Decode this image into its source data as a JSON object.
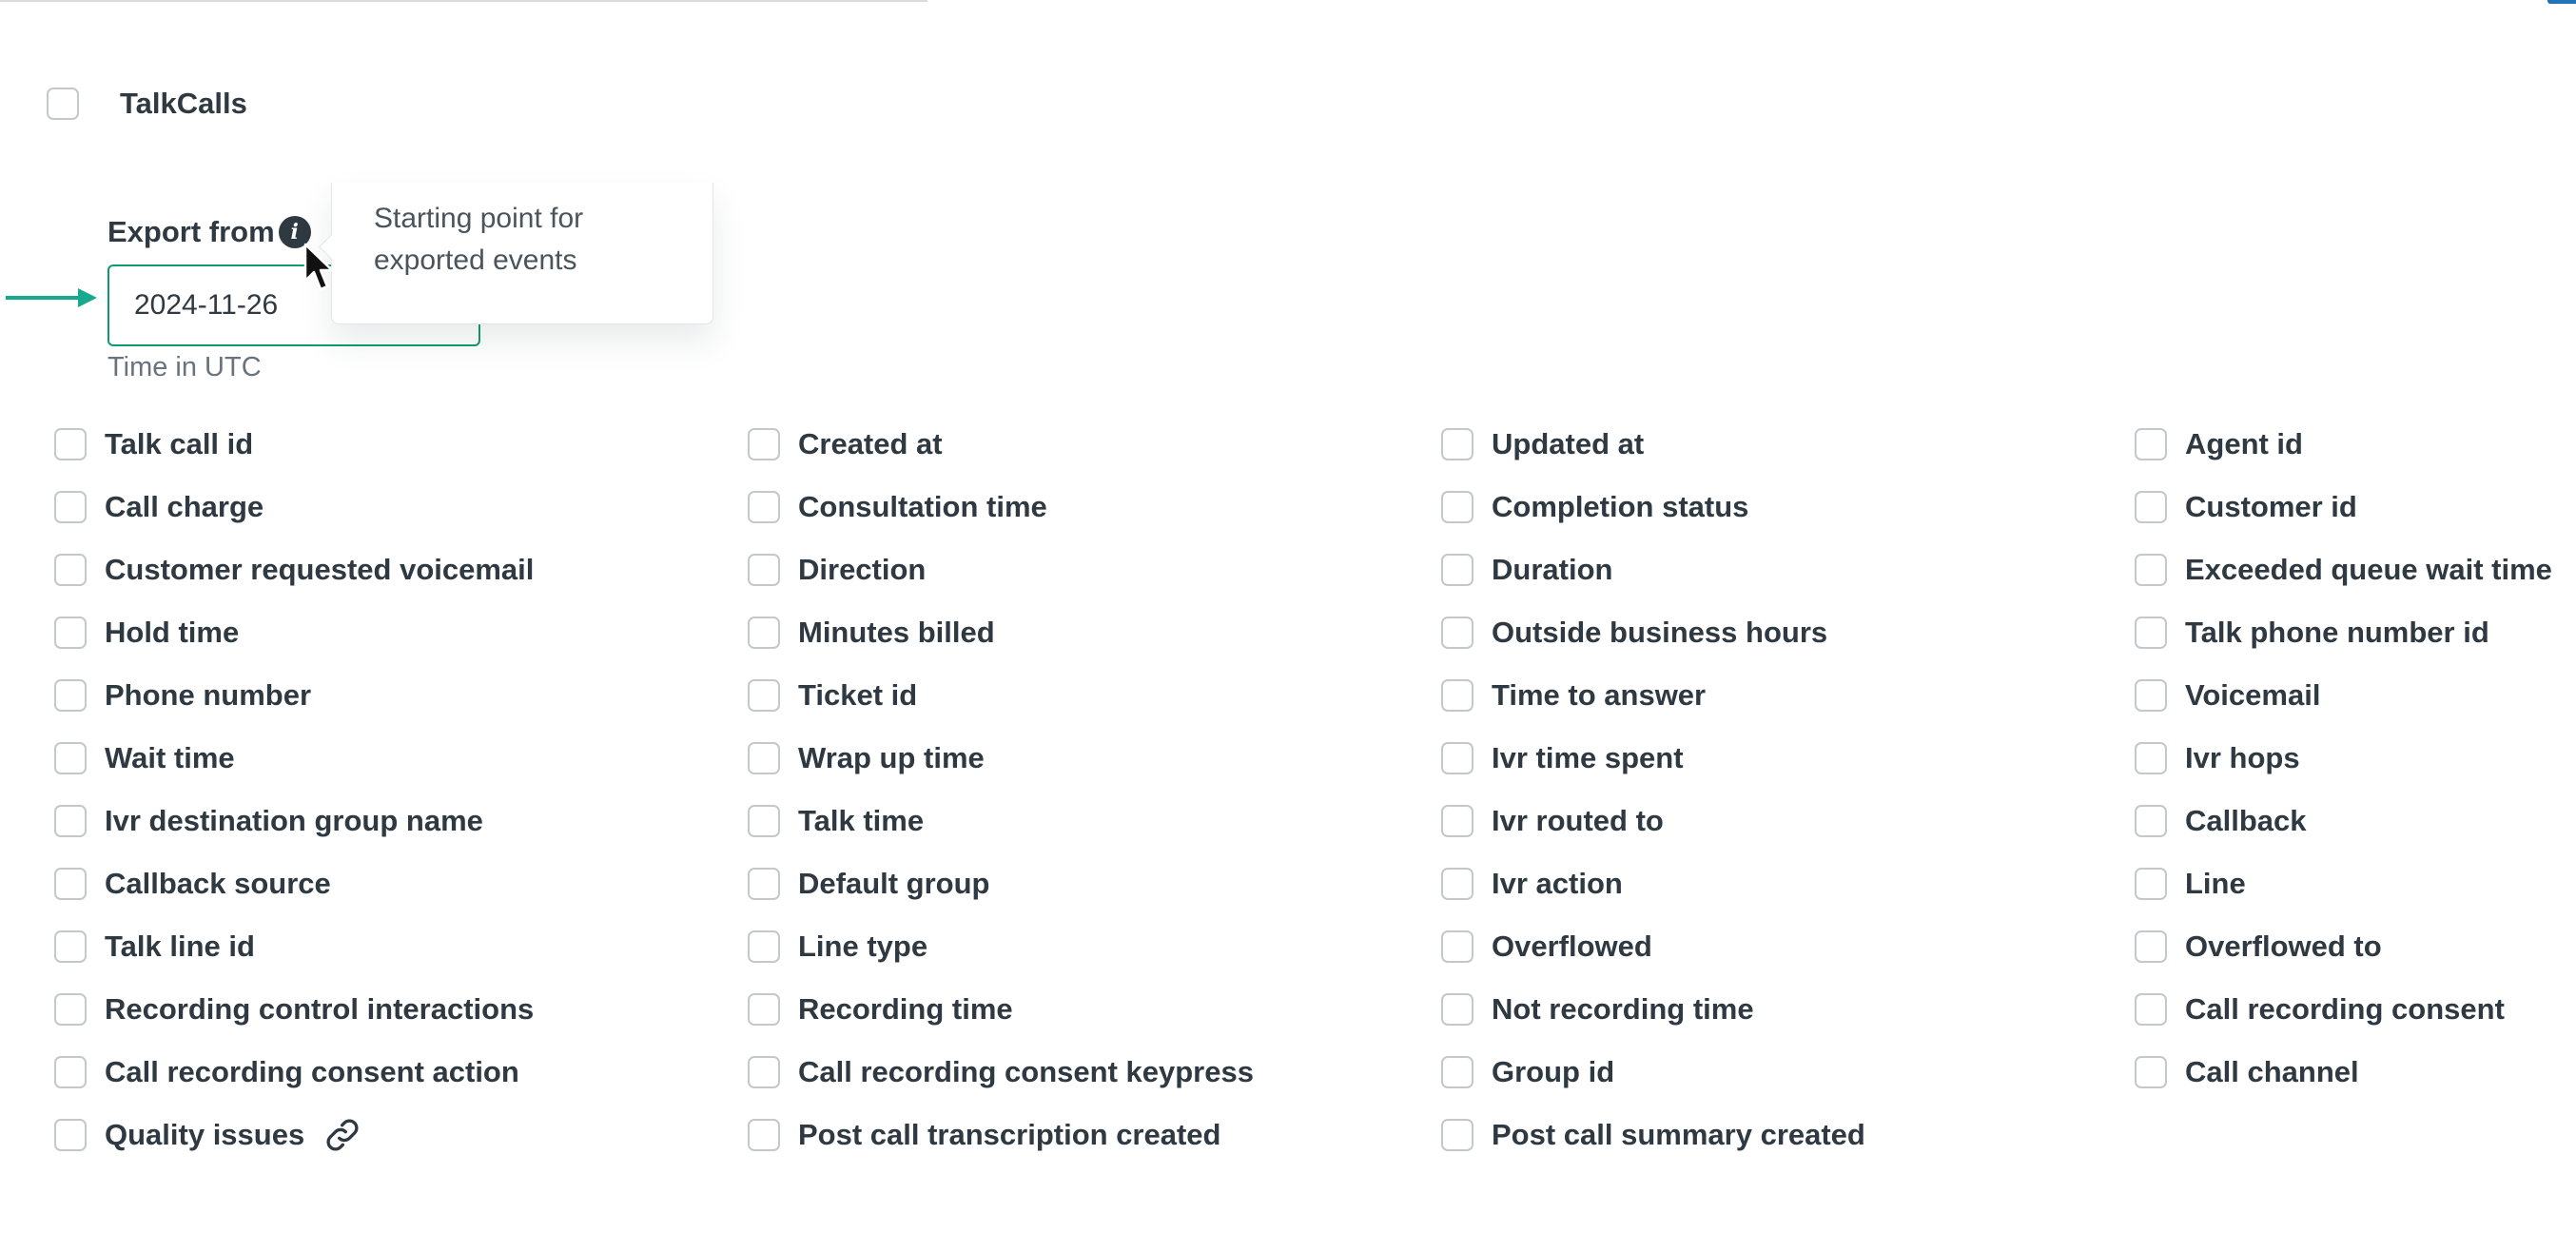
{
  "section": {
    "title": "TalkCalls"
  },
  "export": {
    "label": "Export from",
    "date_value": "2024-11-26",
    "hint": "Time in UTC",
    "tooltip": "Starting point for exported events"
  },
  "fields": [
    "Talk call id",
    "Created at",
    "Updated at",
    "Agent id",
    "Call charge",
    "Consultation time",
    "Completion status",
    "Customer id",
    "Customer requested voicemail",
    "Direction",
    "Duration",
    "Exceeded queue wait time",
    "Hold time",
    "Minutes billed",
    "Outside business hours",
    "Talk phone number id",
    "Phone number",
    "Ticket id",
    "Time to answer",
    "Voicemail",
    "Wait time",
    "Wrap up time",
    "Ivr time spent",
    "Ivr hops",
    "Ivr destination group name",
    "Talk time",
    "Ivr routed to",
    "Callback",
    "Callback source",
    "Default group",
    "Ivr action",
    "Line",
    "Talk line id",
    "Line type",
    "Overflowed",
    "Overflowed to",
    "Recording control interactions",
    "Recording time",
    "Not recording time",
    "Call recording consent",
    "Call recording consent action",
    "Call recording consent keypress",
    "Group id",
    "Call channel",
    "Quality issues",
    "Post call transcription created",
    "Post call summary created"
  ],
  "icons": {
    "info": "info-icon",
    "link": "link-icon",
    "arrow": "arrow-right-icon",
    "cursor": "mouse-pointer-icon"
  },
  "colors": {
    "input_border": "#0f9c6a",
    "arrow": "#17a98e",
    "text": "#2f3941",
    "hint": "#68737d",
    "accent": "#1f73b7"
  }
}
